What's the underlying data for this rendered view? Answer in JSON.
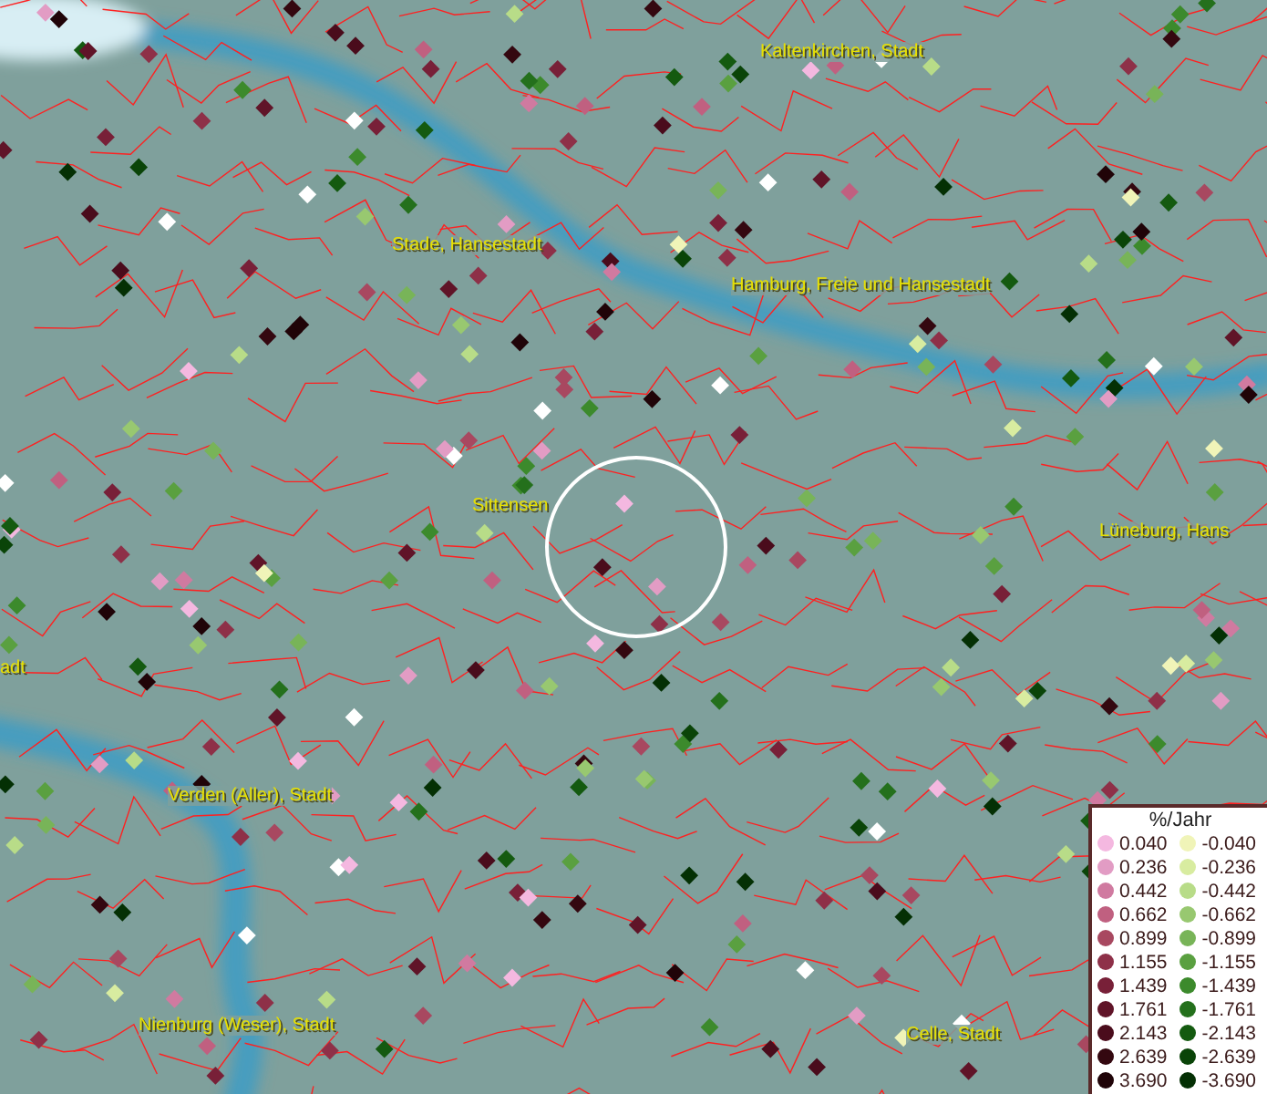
{
  "map": {
    "labels": [
      {
        "text": "Kaltenkirchen, Stadt"
      },
      {
        "text": "Stade, Hansestadt"
      },
      {
        "text": "Hamburg, Freie und Hansestadt"
      },
      {
        "text": "Sittensen"
      },
      {
        "text": "Lüneburg, Hans"
      },
      {
        "text": "adt"
      },
      {
        "text": "Verden (Aller), Stadt"
      },
      {
        "text": "Nienburg (Weser), Stadt"
      },
      {
        "text": "Celle, Stadt"
      }
    ]
  },
  "legend": {
    "title": "%/Jahr",
    "increase": [
      {
        "label": "0.040",
        "color": "#f4b8e0"
      },
      {
        "label": "0.236",
        "color": "#e29cc4"
      },
      {
        "label": "0.442",
        "color": "#d07aa0"
      },
      {
        "label": "0.662",
        "color": "#c06080"
      },
      {
        "label": "0.899",
        "color": "#a84860"
      },
      {
        "label": "1.155",
        "color": "#8e3048"
      },
      {
        "label": "1.439",
        "color": "#782038"
      },
      {
        "label": "1.761",
        "color": "#601428"
      },
      {
        "label": "2.143",
        "color": "#4a0c1c"
      },
      {
        "label": "2.639",
        "color": "#340810"
      },
      {
        "label": "3.690",
        "color": "#200408"
      }
    ],
    "decrease": [
      {
        "label": "-0.040",
        "color": "#f0f4b8"
      },
      {
        "label": "-0.236",
        "color": "#d8eca0"
      },
      {
        "label": "-0.442",
        "color": "#b8dc88"
      },
      {
        "label": "-0.662",
        "color": "#98c870"
      },
      {
        "label": "-0.899",
        "color": "#78b458"
      },
      {
        "label": "-1.155",
        "color": "#5aa040"
      },
      {
        "label": "-1.439",
        "color": "#3c8a2c"
      },
      {
        "label": "-1.761",
        "color": "#24701c"
      },
      {
        "label": "-2.143",
        "color": "#145a10"
      },
      {
        "label": "-2.639",
        "color": "#0a4408"
      },
      {
        "label": "-3.690",
        "color": "#043004"
      }
    ]
  }
}
